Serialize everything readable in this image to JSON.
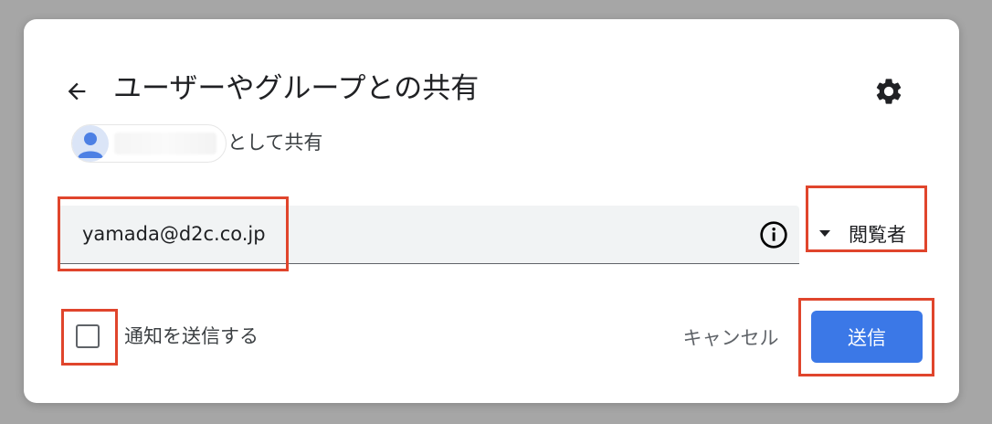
{
  "dialog": {
    "title": "ユーザーやグループとの共有",
    "back_icon": "arrow-left-icon",
    "settings_icon": "gear-icon"
  },
  "account": {
    "avatar_icon": "person-avatar-icon",
    "share_as_label": "として共有"
  },
  "invite": {
    "email_value": "yamada@d2c.co.jp",
    "info_icon": "info-icon",
    "role_caret_icon": "caret-down-icon",
    "role_label": "閲覧者"
  },
  "footer": {
    "notify_label": "通知を送信する",
    "notify_checked": false,
    "cancel_label": "キャンセル",
    "send_label": "送信"
  },
  "colors": {
    "primary": "#3b78e7",
    "highlight": "#e0452c",
    "backdrop": "#a6a6a6"
  }
}
